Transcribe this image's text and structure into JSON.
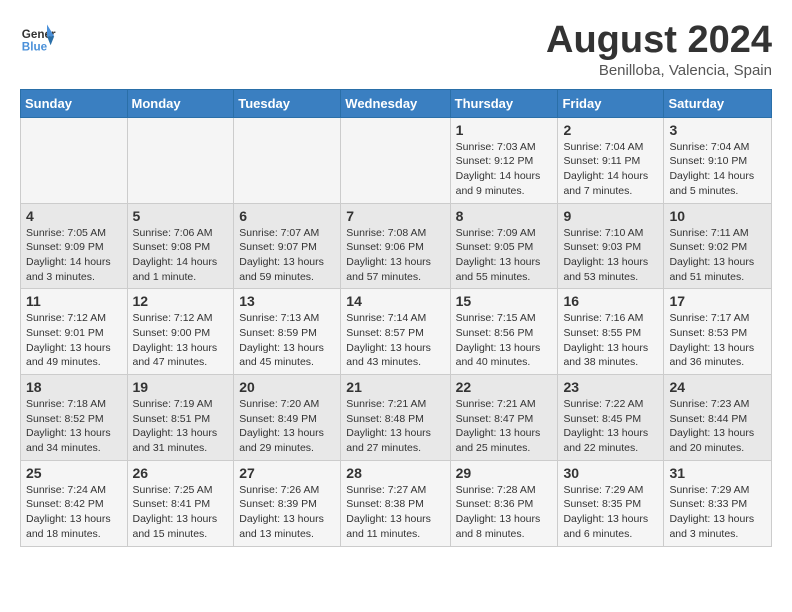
{
  "header": {
    "logo_line1": "General",
    "logo_line2": "Blue",
    "month_title": "August 2024",
    "location": "Benilloba, Valencia, Spain"
  },
  "days_of_week": [
    "Sunday",
    "Monday",
    "Tuesday",
    "Wednesday",
    "Thursday",
    "Friday",
    "Saturday"
  ],
  "weeks": [
    [
      {
        "day": "",
        "info": ""
      },
      {
        "day": "",
        "info": ""
      },
      {
        "day": "",
        "info": ""
      },
      {
        "day": "",
        "info": ""
      },
      {
        "day": "1",
        "info": "Sunrise: 7:03 AM\nSunset: 9:12 PM\nDaylight: 14 hours\nand 9 minutes."
      },
      {
        "day": "2",
        "info": "Sunrise: 7:04 AM\nSunset: 9:11 PM\nDaylight: 14 hours\nand 7 minutes."
      },
      {
        "day": "3",
        "info": "Sunrise: 7:04 AM\nSunset: 9:10 PM\nDaylight: 14 hours\nand 5 minutes."
      }
    ],
    [
      {
        "day": "4",
        "info": "Sunrise: 7:05 AM\nSunset: 9:09 PM\nDaylight: 14 hours\nand 3 minutes."
      },
      {
        "day": "5",
        "info": "Sunrise: 7:06 AM\nSunset: 9:08 PM\nDaylight: 14 hours\nand 1 minute."
      },
      {
        "day": "6",
        "info": "Sunrise: 7:07 AM\nSunset: 9:07 PM\nDaylight: 13 hours\nand 59 minutes."
      },
      {
        "day": "7",
        "info": "Sunrise: 7:08 AM\nSunset: 9:06 PM\nDaylight: 13 hours\nand 57 minutes."
      },
      {
        "day": "8",
        "info": "Sunrise: 7:09 AM\nSunset: 9:05 PM\nDaylight: 13 hours\nand 55 minutes."
      },
      {
        "day": "9",
        "info": "Sunrise: 7:10 AM\nSunset: 9:03 PM\nDaylight: 13 hours\nand 53 minutes."
      },
      {
        "day": "10",
        "info": "Sunrise: 7:11 AM\nSunset: 9:02 PM\nDaylight: 13 hours\nand 51 minutes."
      }
    ],
    [
      {
        "day": "11",
        "info": "Sunrise: 7:12 AM\nSunset: 9:01 PM\nDaylight: 13 hours\nand 49 minutes."
      },
      {
        "day": "12",
        "info": "Sunrise: 7:12 AM\nSunset: 9:00 PM\nDaylight: 13 hours\nand 47 minutes."
      },
      {
        "day": "13",
        "info": "Sunrise: 7:13 AM\nSunset: 8:59 PM\nDaylight: 13 hours\nand 45 minutes."
      },
      {
        "day": "14",
        "info": "Sunrise: 7:14 AM\nSunset: 8:57 PM\nDaylight: 13 hours\nand 43 minutes."
      },
      {
        "day": "15",
        "info": "Sunrise: 7:15 AM\nSunset: 8:56 PM\nDaylight: 13 hours\nand 40 minutes."
      },
      {
        "day": "16",
        "info": "Sunrise: 7:16 AM\nSunset: 8:55 PM\nDaylight: 13 hours\nand 38 minutes."
      },
      {
        "day": "17",
        "info": "Sunrise: 7:17 AM\nSunset: 8:53 PM\nDaylight: 13 hours\nand 36 minutes."
      }
    ],
    [
      {
        "day": "18",
        "info": "Sunrise: 7:18 AM\nSunset: 8:52 PM\nDaylight: 13 hours\nand 34 minutes."
      },
      {
        "day": "19",
        "info": "Sunrise: 7:19 AM\nSunset: 8:51 PM\nDaylight: 13 hours\nand 31 minutes."
      },
      {
        "day": "20",
        "info": "Sunrise: 7:20 AM\nSunset: 8:49 PM\nDaylight: 13 hours\nand 29 minutes."
      },
      {
        "day": "21",
        "info": "Sunrise: 7:21 AM\nSunset: 8:48 PM\nDaylight: 13 hours\nand 27 minutes."
      },
      {
        "day": "22",
        "info": "Sunrise: 7:21 AM\nSunset: 8:47 PM\nDaylight: 13 hours\nand 25 minutes."
      },
      {
        "day": "23",
        "info": "Sunrise: 7:22 AM\nSunset: 8:45 PM\nDaylight: 13 hours\nand 22 minutes."
      },
      {
        "day": "24",
        "info": "Sunrise: 7:23 AM\nSunset: 8:44 PM\nDaylight: 13 hours\nand 20 minutes."
      }
    ],
    [
      {
        "day": "25",
        "info": "Sunrise: 7:24 AM\nSunset: 8:42 PM\nDaylight: 13 hours\nand 18 minutes."
      },
      {
        "day": "26",
        "info": "Sunrise: 7:25 AM\nSunset: 8:41 PM\nDaylight: 13 hours\nand 15 minutes."
      },
      {
        "day": "27",
        "info": "Sunrise: 7:26 AM\nSunset: 8:39 PM\nDaylight: 13 hours\nand 13 minutes."
      },
      {
        "day": "28",
        "info": "Sunrise: 7:27 AM\nSunset: 8:38 PM\nDaylight: 13 hours\nand 11 minutes."
      },
      {
        "day": "29",
        "info": "Sunrise: 7:28 AM\nSunset: 8:36 PM\nDaylight: 13 hours\nand 8 minutes."
      },
      {
        "day": "30",
        "info": "Sunrise: 7:29 AM\nSunset: 8:35 PM\nDaylight: 13 hours\nand 6 minutes."
      },
      {
        "day": "31",
        "info": "Sunrise: 7:29 AM\nSunset: 8:33 PM\nDaylight: 13 hours\nand 3 minutes."
      }
    ]
  ]
}
